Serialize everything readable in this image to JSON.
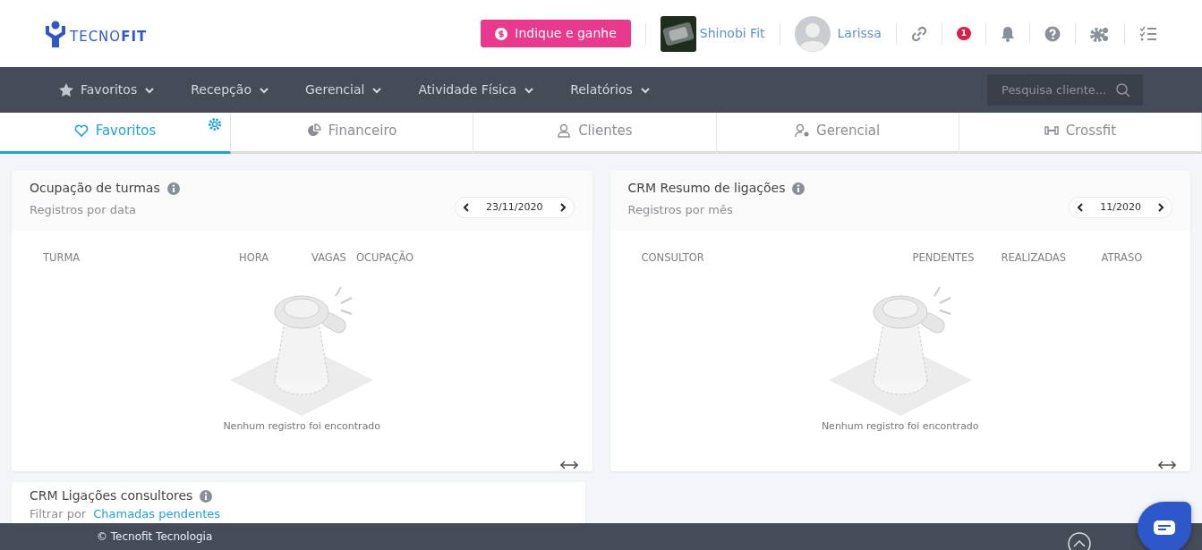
{
  "brand": {
    "logo_text": "TECNO**FIT**"
  },
  "header": {
    "refer_button": "Indique e ganhe",
    "company": "Shinobi Fit",
    "user": "Larissa",
    "notification_count": "1"
  },
  "menu": [
    {
      "label": "Favoritos",
      "kind": "starred"
    },
    {
      "label": "Recepção",
      "kind": "plain"
    },
    {
      "label": "Gerencial",
      "kind": "plain"
    },
    {
      "label": "Atividade Física",
      "kind": "plain"
    },
    {
      "label": "Relatórios",
      "kind": "plain"
    }
  ],
  "search": {
    "placeholder": "Pesquisa cliente..."
  },
  "tabs": [
    {
      "label": "Favoritos",
      "kind": "heart",
      "selected": true,
      "settings": true
    },
    {
      "label": "Financeiro",
      "kind": "chart",
      "selected": false,
      "settings": false
    },
    {
      "label": "Clientes",
      "kind": "user",
      "selected": false,
      "settings": false
    },
    {
      "label": "Gerencial",
      "kind": "usergear",
      "selected": false,
      "settings": false
    },
    {
      "label": "Crossfit",
      "kind": "dumbbell",
      "selected": false,
      "settings": false
    }
  ],
  "cards": [
    {
      "title": "Ocupação de turmas",
      "subtitle": "Registros por data",
      "period": "23/11/2020",
      "columns": [
        "TURMA",
        "HORA",
        "VAGAS",
        "OCUPAÇÃO"
      ],
      "empty_message": "Nenhum registro foi encontrado"
    },
    {
      "title": "CRM Resumo de ligações",
      "subtitle": "Registros por mês",
      "period": "11/2020",
      "columns": [
        "CONSULTOR",
        "PENDENTES",
        "REALIZADAS",
        "ATRASO"
      ],
      "empty_message": "Nenhum registro foi encontrado"
    }
  ],
  "bottom_card": {
    "title": "CRM Ligações consultores",
    "filter_label": "Filtrar por",
    "filter_value": "Chamadas pendentes"
  },
  "footer": {
    "copyright": "© Tecnofit Tecnologia"
  }
}
